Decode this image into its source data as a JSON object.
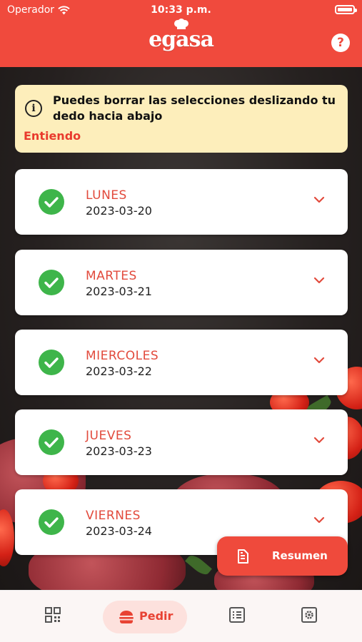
{
  "status": {
    "carrier": "Operador",
    "time": "10:33 p.m."
  },
  "header": {
    "logo_text": "egasa",
    "help_label": "?"
  },
  "banner": {
    "message": "Puedes borrar las selecciones deslizando tu dedo hacia abajo",
    "action": "Entiendo",
    "icon": "info-icon"
  },
  "days": [
    {
      "name": "LUNES",
      "date": "2023-03-20",
      "status": "check-icon"
    },
    {
      "name": "MARTES",
      "date": "2023-03-21",
      "status": "check-icon"
    },
    {
      "name": "MIERCOLES",
      "date": "2023-03-22",
      "status": "check-icon"
    },
    {
      "name": "JUEVES",
      "date": "2023-03-23",
      "status": "check-icon"
    },
    {
      "name": "VIERNES",
      "date": "2023-03-24",
      "status": "check-icon"
    }
  ],
  "fab": {
    "label": "Resumen",
    "icon": "receipt-icon"
  },
  "tabbar": {
    "tabs": [
      {
        "icon": "qr-code-icon",
        "label": ""
      },
      {
        "icon": "burger-icon",
        "label": "Pedir",
        "active": true
      },
      {
        "icon": "list-icon",
        "label": ""
      },
      {
        "icon": "settings-icon",
        "label": ""
      }
    ]
  },
  "colors": {
    "brand": "#f04a3d",
    "check": "#3eb54a",
    "banner_bg": "#fdeebb",
    "day_text": "#e24a3c"
  }
}
